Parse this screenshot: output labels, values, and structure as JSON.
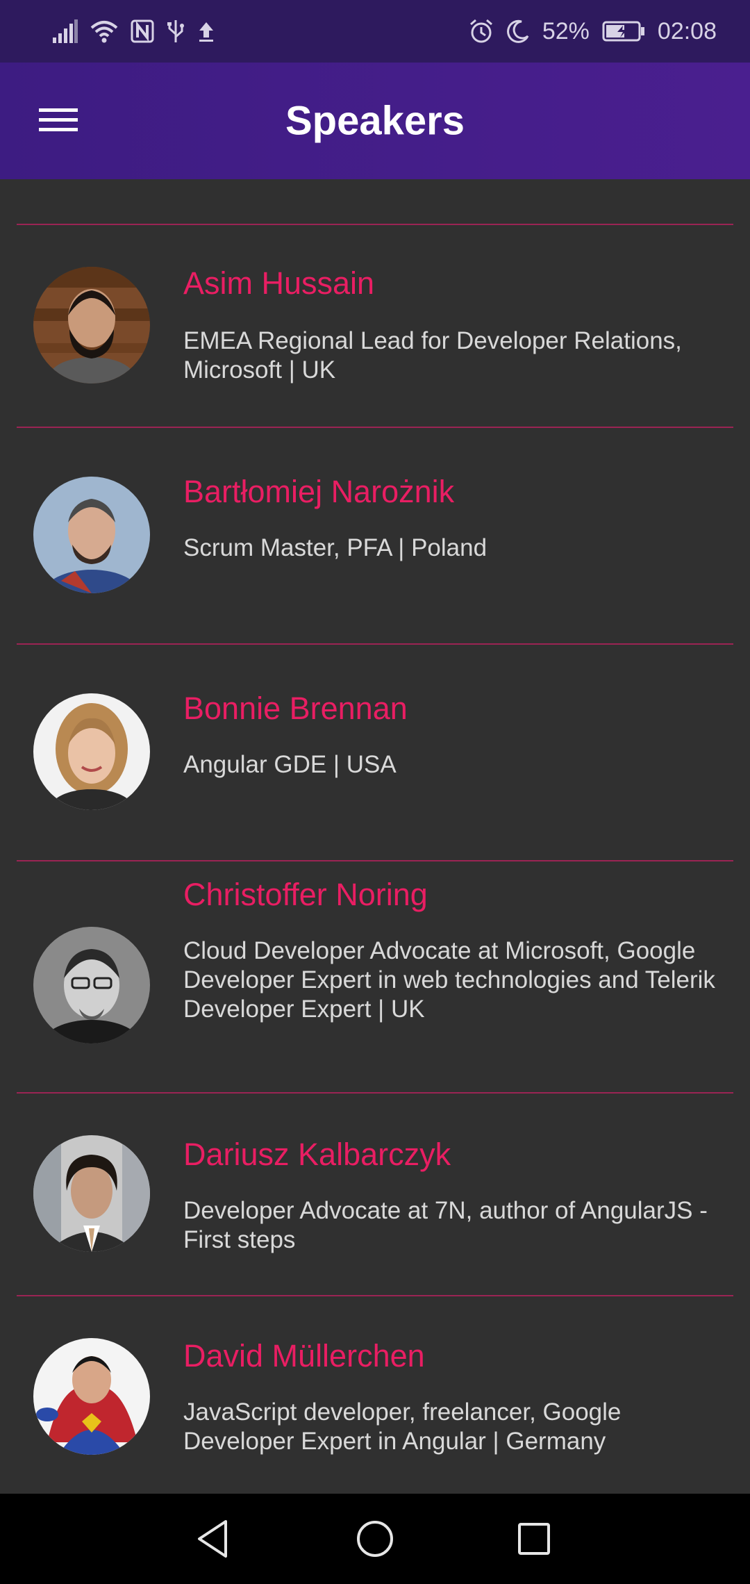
{
  "status_bar": {
    "battery_percent": "52%",
    "time": "02:08",
    "icons_left": [
      "signal-icon",
      "wifi-icon",
      "nfc-icon",
      "usb-icon",
      "upload-icon"
    ],
    "icons_right": [
      "alarm-icon",
      "moon-icon",
      "battery-charging-icon"
    ]
  },
  "app_bar": {
    "title": "Speakers",
    "menu_icon": "hamburger-menu-icon",
    "background": "#3d1c82"
  },
  "colors": {
    "accent": "#e91e63",
    "divider": "#9b2454",
    "background": "#303030",
    "bio_text": "#d9d9d9"
  },
  "speakers": [
    {
      "name": "Asim Hussain",
      "bio": "EMEA Regional Lead for Developer Relations, Microsoft | UK"
    },
    {
      "name": "Bartłomiej Narożnik",
      "bio": "Scrum Master, PFA | Poland"
    },
    {
      "name": "Bonnie Brennan",
      "bio": "Angular GDE | USA"
    },
    {
      "name": "Christoffer Noring",
      "bio": "Cloud Developer Advocate at Microsoft, Google Developer Expert in web technologies and Telerik Developer Expert | UK"
    },
    {
      "name": "Dariusz Kalbarczyk",
      "bio": "Developer Advocate at 7N, author of AngularJS - First steps"
    },
    {
      "name": "David Müllerchen",
      "bio": "JavaScript developer, freelancer, Google Developer Expert in Angular | Germany"
    }
  ],
  "nav_bar": {
    "buttons": [
      "back-icon",
      "home-icon",
      "recents-icon"
    ]
  }
}
